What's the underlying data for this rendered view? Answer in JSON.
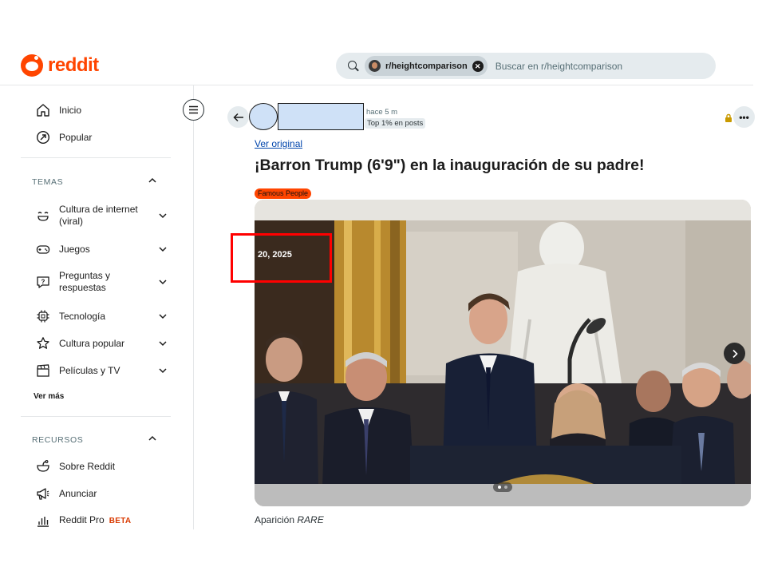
{
  "header": {
    "logo_text": "reddit",
    "search_chip": "r/heightcomparison",
    "search_placeholder": "Buscar en r/heightcomparison"
  },
  "sidebar": {
    "top_items": [
      {
        "label": "Inicio",
        "icon": "home-icon"
      },
      {
        "label": "Popular",
        "icon": "popular-icon"
      }
    ],
    "topics_title": "TEMAS",
    "topics": [
      {
        "label_line1": "Cultura de internet",
        "label_line2": "(viral)",
        "icon": "smile-icon"
      },
      {
        "label_line1": "Juegos",
        "label_line2": "",
        "icon": "gamepad-icon"
      },
      {
        "label_line1": "Preguntas y",
        "label_line2": "respuestas",
        "icon": "question-icon"
      },
      {
        "label_line1": "Tecnología",
        "label_line2": "",
        "icon": "chip-icon"
      },
      {
        "label_line1": "Cultura popular",
        "label_line2": "",
        "icon": "star-icon"
      },
      {
        "label_line1": "Películas y TV",
        "label_line2": "",
        "icon": "clapper-icon"
      }
    ],
    "see_more": "Ver más",
    "resources_title": "RECURSOS",
    "resources": [
      {
        "label": "Sobre Reddit",
        "icon": "reddit-icon"
      },
      {
        "label": "Anunciar",
        "icon": "megaphone-icon"
      },
      {
        "label": "Reddit Pro",
        "badge": "BETA",
        "icon": "bar-chart-icon"
      }
    ]
  },
  "post": {
    "time": "hace 5 m",
    "badge": "Top 1% en posts",
    "view_original": "Ver original",
    "title": "¡Barron Trump (6'9\") en la inauguración de su padre!",
    "flair": "Famous People",
    "image_date_text": "20, 2025",
    "caption_prefix": "Aparición ",
    "caption_italic": "RARE"
  },
  "colors": {
    "brand": "#ff4500",
    "link": "#0045ac",
    "highlight": "#ff0000",
    "redaction": "#cfe1f7"
  }
}
